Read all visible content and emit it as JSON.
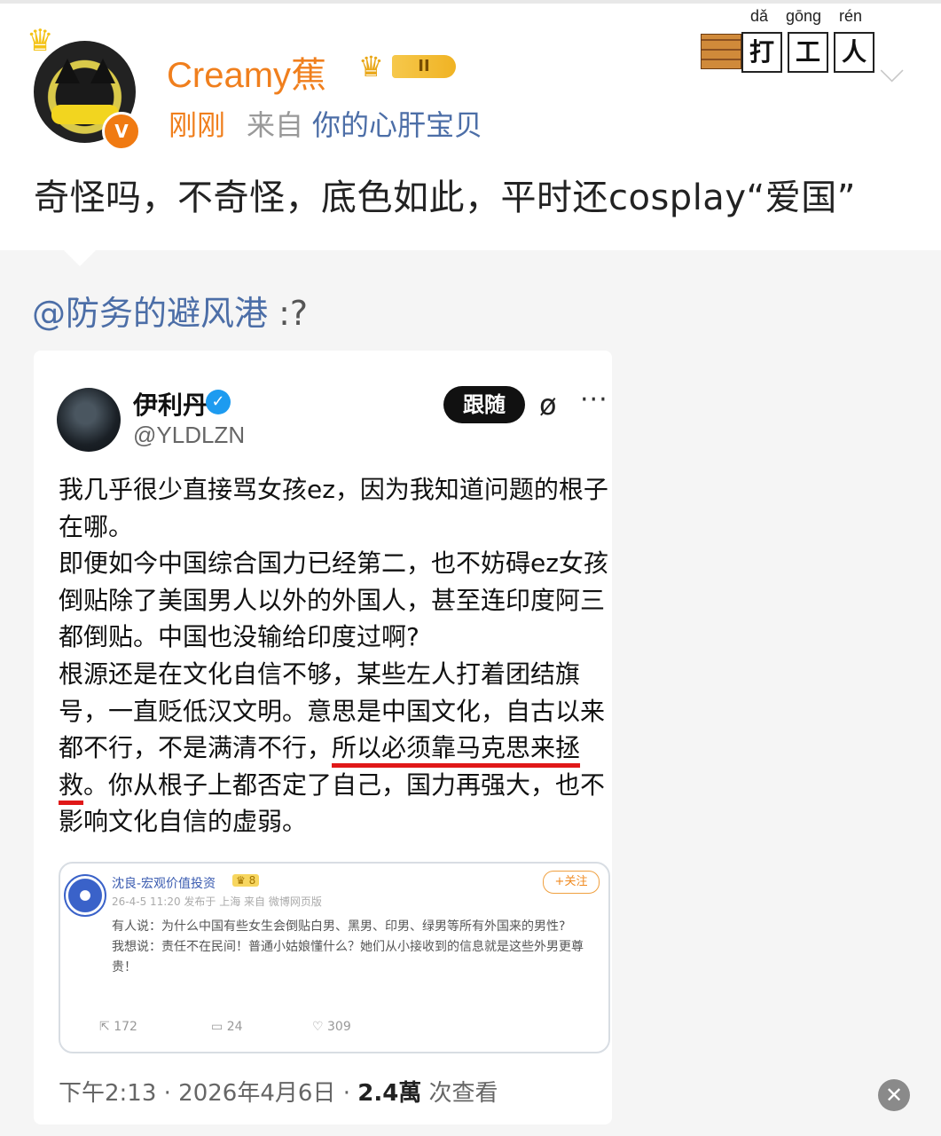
{
  "author": {
    "name": "Creamy蕉",
    "level": "II",
    "verified_badge": "V",
    "time": "刚刚",
    "source_prefix": "来自",
    "source": "你的心肝宝贝"
  },
  "stamp": {
    "pinyin": [
      "dǎ",
      "gōng",
      "rén"
    ],
    "chars": [
      "打",
      "工",
      "人"
    ]
  },
  "post_text": "奇怪吗，不奇怪，底色如此，平时还cosplay“爱国”",
  "repost": {
    "mention": "@防务的避风港",
    "rest": " :?"
  },
  "tweet": {
    "name": "伊利丹",
    "handle": "@YLDLZN",
    "follow_label": "跟随",
    "more_label": "···",
    "body": {
      "p1": "我几乎很少直接骂女孩ez，因为我知道问题的根子在哪。",
      "p2": "即便如今中国综合国力已经第二，也不妨碍ez女孩倒贴除了美国男人以外的外国人，甚至连印度阿三都倒贴。中国也没输给印度过啊?",
      "p3_a": "根源还是在文化自信不够，某些左人打着团结旗号，一直贬低汉文明。意思是中国文化，自古以来都不行，不是满清不行，",
      "p3_hl": "所以必须靠马克思来拯救",
      "p3_b": "。你从根子上都否定了自己，国力再强大，也不影响文化自信的虚弱。"
    },
    "quoted": {
      "name": "沈良-宏观价值投资",
      "level": "♛ 8",
      "follow": "+关注",
      "meta": "26-4-5 11:20 发布于 上海 来自 微博网页版",
      "line1": "有人说：为什么中国有些女生会倒贴白男、黑男、印男、绿男等所有外国来的男性?",
      "line2": "我想说：责任不在民间！普通小姑娘懂什么？她们从小接收到的信息就是这些外男更尊贵！",
      "reposts": "172",
      "comments": "24",
      "likes": "309"
    },
    "footer": {
      "time": "下午2:13 · 2026年4月6日 · ",
      "views": "2.4萬",
      "views_label": " 次查看"
    }
  },
  "colors": {
    "accent_orange": "#f07f1d",
    "link_blue": "#4c6ea7",
    "highlight_red": "#e01818"
  },
  "icons": [
    "crown-icon",
    "chevron-down-icon",
    "verified-icon",
    "grok-icon",
    "more-icon",
    "repost-icon",
    "comment-icon",
    "like-icon",
    "close-icon"
  ]
}
